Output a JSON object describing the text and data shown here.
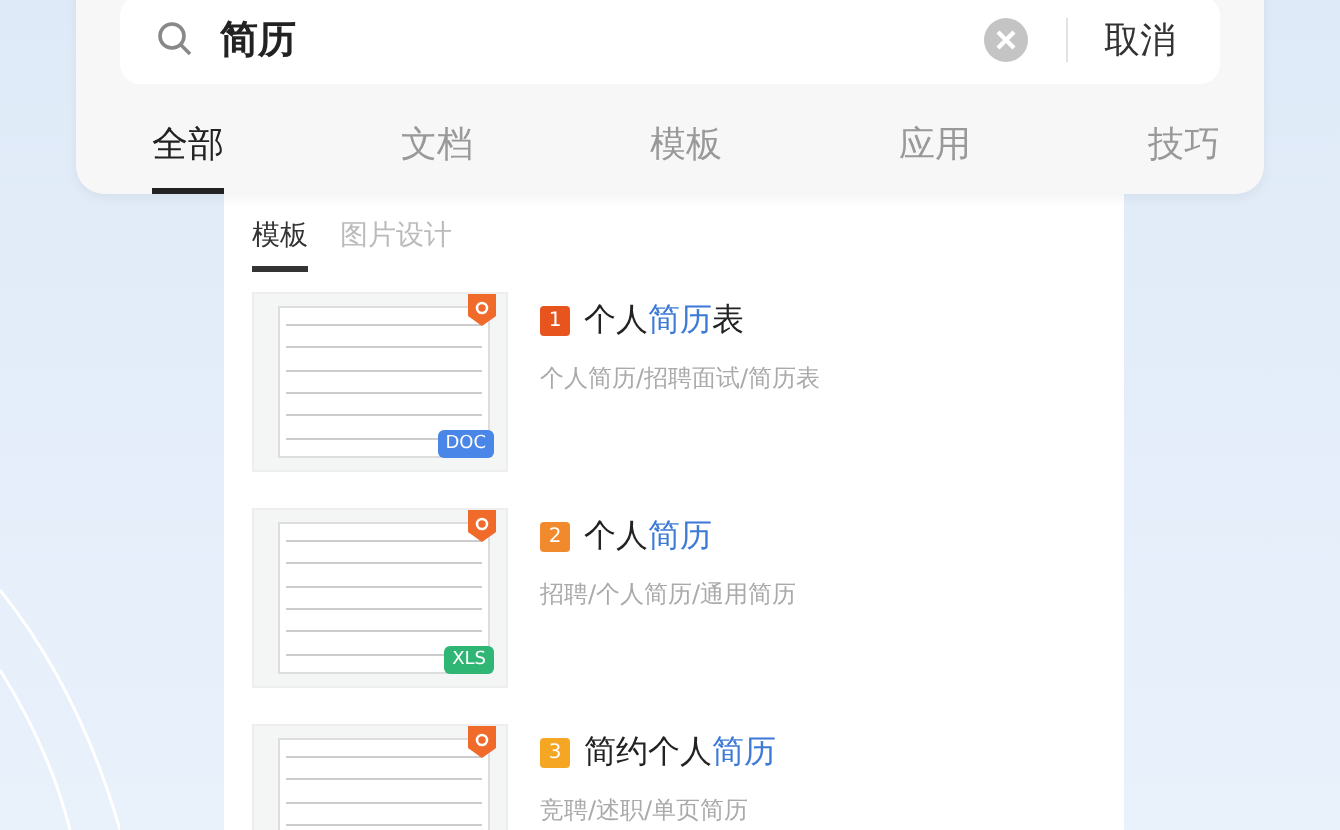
{
  "search": {
    "value": "简历",
    "cancel": "取消"
  },
  "tabs": [
    {
      "label": "全部",
      "selected": true
    },
    {
      "label": "文档",
      "selected": false
    },
    {
      "label": "模板",
      "selected": false
    },
    {
      "label": "应用",
      "selected": false
    },
    {
      "label": "技巧",
      "selected": false
    }
  ],
  "subtabs": [
    {
      "label": "模板",
      "selected": true
    },
    {
      "label": "图片设计",
      "selected": false
    }
  ],
  "results": [
    {
      "rank": "1",
      "color": "#e8541e",
      "title": [
        {
          "text": "个人",
          "highlight": false
        },
        {
          "text": "简历",
          "highlight": true
        },
        {
          "text": "表",
          "highlight": false
        }
      ],
      "tags": "个人简历/招聘面试/简历表",
      "file_badge": {
        "label": "DOC",
        "color": "#4a86e8"
      }
    },
    {
      "rank": "2",
      "color": "#f08a2c",
      "title": [
        {
          "text": "个人",
          "highlight": false
        },
        {
          "text": "简历",
          "highlight": true
        }
      ],
      "tags": "招聘/个人简历/通用简历",
      "file_badge": {
        "label": "XLS",
        "color": "#2fb574"
      }
    },
    {
      "rank": "3",
      "color": "#f5a623",
      "title": [
        {
          "text": "简约个人",
          "highlight": false
        },
        {
          "text": "简历",
          "highlight": true
        }
      ],
      "tags": "竞聘/述职/单页简历"
    }
  ]
}
